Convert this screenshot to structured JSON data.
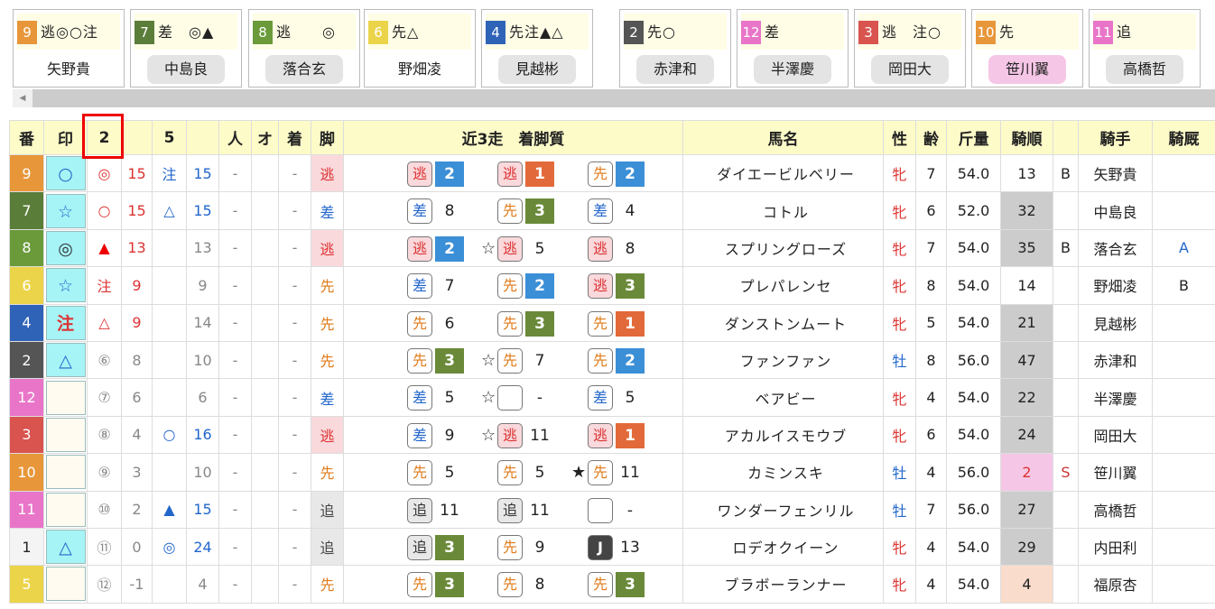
{
  "cards": [
    {
      "num": "9",
      "color": "#e8963a",
      "marks": "逃◎○注",
      "name": "矢野貴",
      "name_bg": "#fff"
    },
    {
      "num": "7",
      "color": "#5a7d3a",
      "marks": "差　◎▲",
      "name": "中島良",
      "name_bg": "#e4e4e4"
    },
    {
      "num": "8",
      "color": "#6a9a3a",
      "marks": "逃　　◎",
      "name": "落合玄",
      "name_bg": "#e4e4e4"
    },
    {
      "num": "6",
      "color": "#ecd44a",
      "marks": "先△",
      "name": "野畑凌",
      "name_bg": "#fff"
    },
    {
      "num": "4",
      "color": "#2f63b8",
      "marks": "先注▲△",
      "name": "見越彬",
      "name_bg": "#e4e4e4"
    },
    {
      "num": "2",
      "color": "#555555",
      "marks": "先○",
      "name": "赤津和",
      "name_bg": "#e4e4e4"
    },
    {
      "num": "12",
      "color": "#e975c8",
      "marks": "差",
      "name": "半澤慶",
      "name_bg": "#e4e4e4"
    },
    {
      "num": "3",
      "color": "#d9534f",
      "marks": "逃　注○",
      "name": "岡田大",
      "name_bg": "#e4e4e4"
    },
    {
      "num": "10",
      "color": "#e8963a",
      "marks": "先",
      "name": "笹川翼",
      "name_bg": "#f6c6e6"
    },
    {
      "num": "11",
      "color": "#e975c8",
      "marks": "追",
      "name": "高橋哲",
      "name_bg": "#e4e4e4"
    }
  ],
  "headers": [
    "番",
    "印",
    "2",
    "",
    "5",
    "",
    "人",
    "オ",
    "着",
    "脚",
    "近3走　着脚質",
    "馬名",
    "性",
    "齢",
    "斤量",
    "騎順",
    "",
    "騎手",
    "騎厩"
  ],
  "rows": [
    {
      "ban": "9",
      "ban_color": "#e8963a",
      "mark": "○",
      "m2": "◎",
      "v2": "15",
      "m5": "注",
      "v5": "15",
      "ninki": "-",
      "odds": "",
      "chaku": "-",
      "ashi": "逃",
      "hist": [
        [
          "逃",
          "2",
          "#3b8fd6"
        ],
        [
          "逃",
          "1",
          "#e26a3a"
        ],
        [
          "先",
          "2",
          "#3b8fd6"
        ]
      ],
      "star1": "",
      "star2": "",
      "name": "ダイエービルベリー",
      "sex": "牝",
      "age": "7",
      "kin": "54.0",
      "kijun": "13",
      "kijun_bg": "#fff",
      "b": "B",
      "jockey": "矢野貴",
      "kyu": ""
    },
    {
      "ban": "7",
      "ban_color": "#5a7d3a",
      "mark": "☆",
      "m2": "○",
      "v2": "15",
      "m5": "△",
      "v5": "15",
      "ninki": "-",
      "odds": "",
      "chaku": "-",
      "ashi": "差",
      "hist": [
        [
          "差",
          "8",
          ""
        ],
        [
          "先",
          "3",
          "#6a8a3a"
        ],
        [
          "差",
          "4",
          ""
        ]
      ],
      "star1": "",
      "star2": "",
      "name": "コトル",
      "sex": "牝",
      "age": "6",
      "kin": "52.0",
      "kijun": "32",
      "kijun_bg": "#ccc",
      "b": "",
      "jockey": "中島良",
      "kyu": ""
    },
    {
      "ban": "8",
      "ban_color": "#6a9a3a",
      "mark": "◎",
      "m2": "▲",
      "v2": "13",
      "m5": "",
      "v5": "13",
      "ninki": "-",
      "odds": "",
      "chaku": "-",
      "ashi": "逃",
      "hist": [
        [
          "逃",
          "2",
          "#3b8fd6"
        ],
        [
          "逃",
          "5",
          ""
        ],
        [
          "逃",
          "8",
          ""
        ]
      ],
      "star1": "☆",
      "star2": "",
      "name": "スプリングローズ",
      "sex": "牝",
      "age": "7",
      "kin": "54.0",
      "kijun": "35",
      "kijun_bg": "#ccc",
      "b": "B",
      "jockey": "落合玄",
      "kyu": "A"
    },
    {
      "ban": "6",
      "ban_color": "#ecd44a",
      "mark": "☆",
      "m2": "注",
      "v2": "9",
      "m5": "",
      "v5": "9",
      "ninki": "-",
      "odds": "",
      "chaku": "-",
      "ashi": "先",
      "hist": [
        [
          "差",
          "7",
          ""
        ],
        [
          "先",
          "2",
          "#3b8fd6"
        ],
        [
          "逃",
          "3",
          "#6a8a3a"
        ]
      ],
      "star1": "",
      "star2": "",
      "name": "プレパレンセ",
      "sex": "牝",
      "age": "8",
      "kin": "54.0",
      "kijun": "14",
      "kijun_bg": "#fff",
      "b": "",
      "jockey": "野畑凌",
      "kyu": "B"
    },
    {
      "ban": "4",
      "ban_color": "#2f63b8",
      "mark": "注",
      "m2": "△",
      "v2": "9",
      "m5": "",
      "v5": "14",
      "ninki": "-",
      "odds": "",
      "chaku": "-",
      "ashi": "先",
      "hist": [
        [
          "先",
          "6",
          ""
        ],
        [
          "先",
          "3",
          "#6a8a3a"
        ],
        [
          "先",
          "1",
          "#e26a3a"
        ]
      ],
      "star1": "",
      "star2": "",
      "name": "ダンストンムート",
      "sex": "牝",
      "age": "5",
      "kin": "54.0",
      "kijun": "21",
      "kijun_bg": "#ccc",
      "b": "",
      "jockey": "見越彬",
      "kyu": ""
    },
    {
      "ban": "2",
      "ban_color": "#555555",
      "mark": "△",
      "m2": "⑥",
      "v2": "8",
      "m5": "",
      "v5": "10",
      "ninki": "-",
      "odds": "",
      "chaku": "-",
      "ashi": "先",
      "hist": [
        [
          "先",
          "3",
          "#6a8a3a"
        ],
        [
          "先",
          "7",
          ""
        ],
        [
          "先",
          "2",
          "#3b8fd6"
        ]
      ],
      "star1": "☆",
      "star2": "",
      "name": "ファンファン",
      "sex": "牡",
      "age": "8",
      "kin": "56.0",
      "kijun": "47",
      "kijun_bg": "#ccc",
      "b": "",
      "jockey": "赤津和",
      "kyu": ""
    },
    {
      "ban": "12",
      "ban_color": "#e975c8",
      "mark": "",
      "m2": "⑦",
      "v2": "6",
      "m5": "",
      "v5": "6",
      "ninki": "-",
      "odds": "",
      "chaku": "-",
      "ashi": "差",
      "hist": [
        [
          "差",
          "5",
          ""
        ],
        [
          "",
          "-",
          ""
        ],
        [
          "差",
          "5",
          ""
        ]
      ],
      "star1": "☆",
      "star2": "",
      "name": "ベアビー",
      "sex": "牝",
      "age": "4",
      "kin": "54.0",
      "kijun": "22",
      "kijun_bg": "#ccc",
      "b": "",
      "jockey": "半澤慶",
      "kyu": ""
    },
    {
      "ban": "3",
      "ban_color": "#d9534f",
      "mark": "",
      "m2": "⑧",
      "v2": "4",
      "m5": "○",
      "v5": "16",
      "ninki": "-",
      "odds": "",
      "chaku": "-",
      "ashi": "逃",
      "hist": [
        [
          "差",
          "9",
          ""
        ],
        [
          "逃",
          "11",
          ""
        ],
        [
          "逃",
          "1",
          "#e26a3a"
        ]
      ],
      "star1": "☆",
      "star2": "",
      "name": "アカルイスモウブ",
      "sex": "牝",
      "age": "6",
      "kin": "54.0",
      "kijun": "24",
      "kijun_bg": "#ccc",
      "b": "",
      "jockey": "岡田大",
      "kyu": ""
    },
    {
      "ban": "10",
      "ban_color": "#e8963a",
      "mark": "",
      "m2": "⑨",
      "v2": "3",
      "m5": "",
      "v5": "10",
      "ninki": "-",
      "odds": "",
      "chaku": "-",
      "ashi": "先",
      "hist": [
        [
          "先",
          "5",
          ""
        ],
        [
          "先",
          "5",
          ""
        ],
        [
          "先",
          "11",
          ""
        ]
      ],
      "star1": "",
      "star2": "★",
      "name": "カミンスキ",
      "sex": "牡",
      "age": "4",
      "kin": "56.0",
      "kijun": "2",
      "kijun_bg": "#f6c6e6",
      "b": "S",
      "jockey": "笹川翼",
      "kyu": ""
    },
    {
      "ban": "11",
      "ban_color": "#e975c8",
      "mark": "",
      "m2": "⑩",
      "v2": "2",
      "m5": "▲",
      "v5": "15",
      "ninki": "-",
      "odds": "",
      "chaku": "-",
      "ashi": "追",
      "hist": [
        [
          "追",
          "11",
          ""
        ],
        [
          "追",
          "11",
          ""
        ],
        [
          "",
          "-",
          ""
        ]
      ],
      "star1": "",
      "star2": "",
      "name": "ワンダーフェンリル",
      "sex": "牡",
      "age": "7",
      "kin": "56.0",
      "kijun": "27",
      "kijun_bg": "#ccc",
      "b": "",
      "jockey": "高橋哲",
      "kyu": ""
    },
    {
      "ban": "1",
      "ban_color": "#f4f4f4",
      "mark": "△",
      "m2": "⑪",
      "v2": "0",
      "m5": "◎",
      "v5": "24",
      "ninki": "-",
      "odds": "",
      "chaku": "-",
      "ashi": "追",
      "hist": [
        [
          "追",
          "3",
          "#6a8a3a"
        ],
        [
          "先",
          "9",
          ""
        ],
        [
          "J",
          "13",
          ""
        ]
      ],
      "star1": "",
      "star2": "",
      "name": "ロデオクイーン",
      "sex": "牝",
      "age": "4",
      "kin": "54.0",
      "kijun": "29",
      "kijun_bg": "#ccc",
      "b": "",
      "jockey": "内田利",
      "kyu": ""
    },
    {
      "ban": "5",
      "ban_color": "#ecd44a",
      "mark": "",
      "m2": "⑫",
      "v2": "-1",
      "m5": "",
      "v5": "4",
      "ninki": "-",
      "odds": "",
      "chaku": "-",
      "ashi": "先",
      "hist": [
        [
          "先",
          "3",
          "#6a8a3a"
        ],
        [
          "先",
          "8",
          ""
        ],
        [
          "先",
          "3",
          "#6a8a3a"
        ]
      ],
      "star1": "",
      "star2": "",
      "name": "ブラボーランナー",
      "sex": "牝",
      "age": "4",
      "kin": "54.0",
      "kijun": "4",
      "kijun_bg": "#f9dccb",
      "b": "",
      "jockey": "福原杏",
      "kyu": ""
    }
  ],
  "colors": {
    "header_bg": "#fdfbc8",
    "mark_bg": "#a6f4f6",
    "highlight": "#e00000"
  }
}
